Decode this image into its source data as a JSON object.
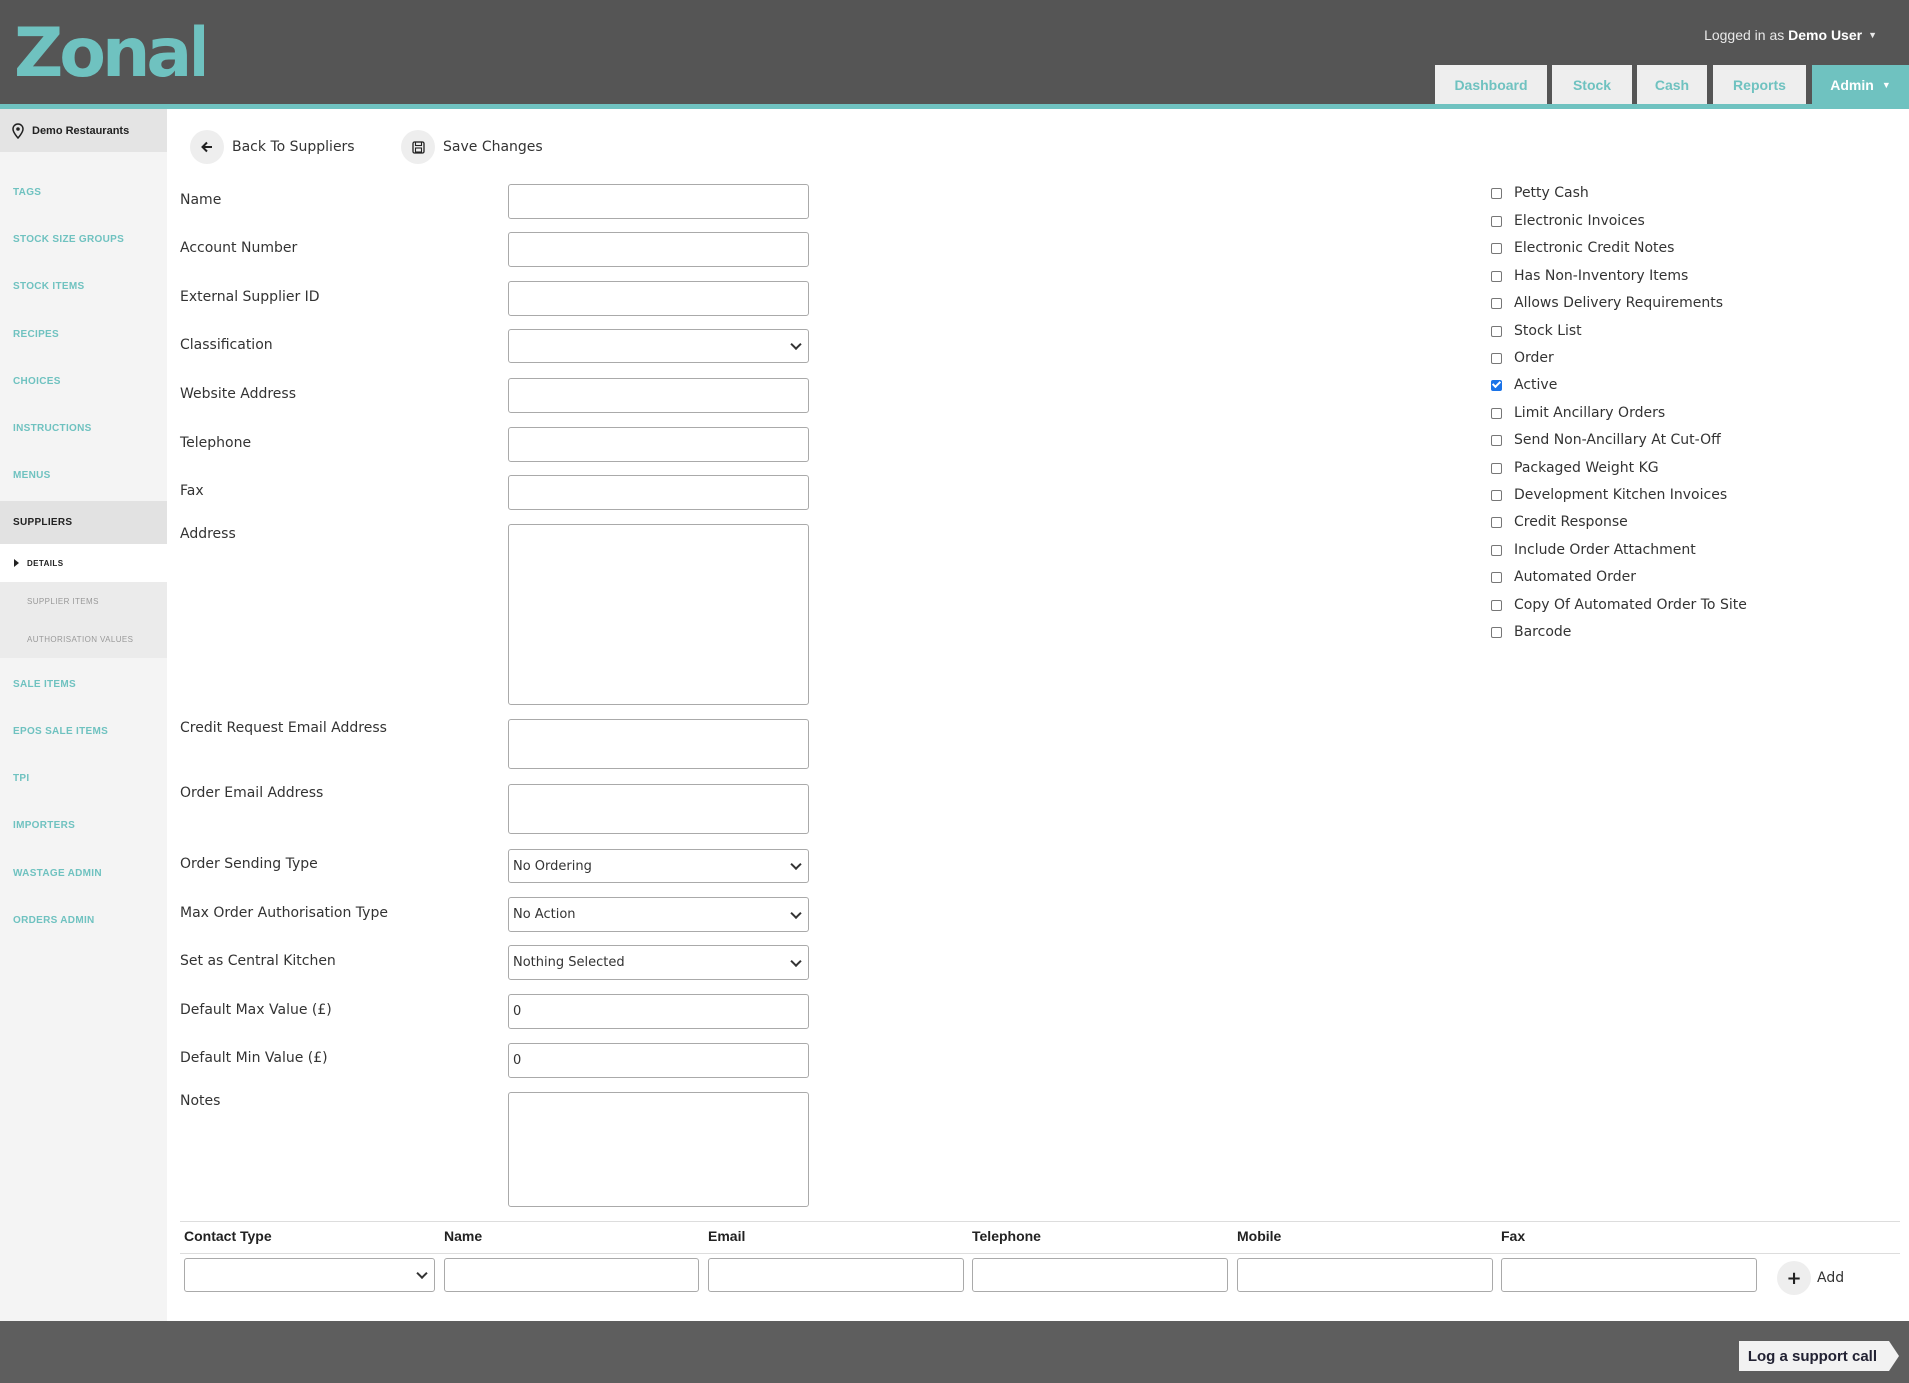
{
  "header": {
    "logo_text": "Zonal",
    "logged_in_prefix": "Logged in as",
    "user_name": "Demo User",
    "nav": [
      {
        "label": "Dashboard"
      },
      {
        "label": "Stock"
      },
      {
        "label": "Cash"
      },
      {
        "label": "Reports"
      },
      {
        "label": "Admin"
      }
    ]
  },
  "colors": {
    "accent": "#6fc2c0",
    "header_bg": "#555555",
    "checkbox_on": "#1a73e8"
  },
  "sidebar": {
    "location": "Demo Restaurants",
    "items": [
      {
        "label": "Tags"
      },
      {
        "label": "Stock Size Groups"
      },
      {
        "label": "Stock Items"
      },
      {
        "label": "Recipes"
      },
      {
        "label": "Choices"
      },
      {
        "label": "Instructions"
      },
      {
        "label": "Menus"
      },
      {
        "label": "Suppliers"
      },
      {
        "label": "Sale Items"
      },
      {
        "label": "EPOS Sale Items"
      },
      {
        "label": "TPI"
      },
      {
        "label": "Importers"
      },
      {
        "label": "Wastage Admin"
      },
      {
        "label": "Orders Admin"
      }
    ],
    "sub_items": [
      {
        "label": "Details"
      },
      {
        "label": "Supplier Items"
      },
      {
        "label": "Authorisation Values"
      }
    ]
  },
  "toolbar": {
    "back_label": "Back To Suppliers",
    "save_label": "Save Changes"
  },
  "form": {
    "labels": {
      "name": "Name",
      "account_number": "Account Number",
      "external_supplier_id": "External Supplier ID",
      "classification": "Classification",
      "website": "Website Address",
      "telephone": "Telephone",
      "fax": "Fax",
      "address": "Address",
      "credit_email": "Credit Request Email Address",
      "order_email": "Order Email Address",
      "order_sending_type": "Order Sending Type",
      "max_order_auth": "Max Order Authorisation Type",
      "central_kitchen": "Set as Central Kitchen",
      "default_max": "Default Max Value (£)",
      "default_min": "Default Min Value (£)",
      "notes": "Notes"
    },
    "values": {
      "order_sending_type": "No Ordering",
      "max_order_auth": "No Action",
      "central_kitchen": "Nothing Selected",
      "default_max": "0",
      "default_min": "0"
    }
  },
  "checkboxes": [
    {
      "label": "Petty Cash",
      "checked": false
    },
    {
      "label": "Electronic Invoices",
      "checked": false
    },
    {
      "label": "Electronic Credit Notes",
      "checked": false
    },
    {
      "label": "Has Non-Inventory Items",
      "checked": false
    },
    {
      "label": "Allows Delivery Requirements",
      "checked": false
    },
    {
      "label": "Stock List",
      "checked": false
    },
    {
      "label": "Order",
      "checked": false
    },
    {
      "label": "Active",
      "checked": true
    },
    {
      "label": "Limit Ancillary Orders",
      "checked": false
    },
    {
      "label": "Send Non-Ancillary At Cut-Off",
      "checked": false
    },
    {
      "label": "Packaged Weight KG",
      "checked": false
    },
    {
      "label": "Development Kitchen Invoices",
      "checked": false
    },
    {
      "label": "Credit Response",
      "checked": false
    },
    {
      "label": "Include Order Attachment",
      "checked": false
    },
    {
      "label": "Automated Order",
      "checked": false
    },
    {
      "label": "Copy Of Automated Order To Site",
      "checked": false
    },
    {
      "label": "Barcode",
      "checked": false
    }
  ],
  "contacts": {
    "headers": [
      "Contact Type",
      "Name",
      "Email",
      "Telephone",
      "Mobile",
      "Fax"
    ],
    "add_label": "Add"
  },
  "footer": {
    "support_label": "Log a support call"
  }
}
